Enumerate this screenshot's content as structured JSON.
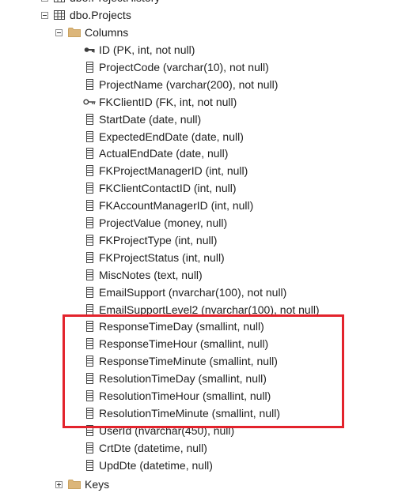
{
  "tree": {
    "top_cut_label": "dbo.ProjectHistory",
    "table_label": "dbo.Projects",
    "columns_folder_label": "Columns",
    "columns": [
      {
        "label": "ID (PK, int, not null)",
        "icon": "primary-key-icon"
      },
      {
        "label": "ProjectCode (varchar(10), not null)",
        "icon": "column-icon"
      },
      {
        "label": "ProjectName (varchar(200), not null)",
        "icon": "column-icon"
      },
      {
        "label": "FKClientID (FK, int, not null)",
        "icon": "foreign-key-icon"
      },
      {
        "label": "StartDate (date, null)",
        "icon": "column-icon"
      },
      {
        "label": "ExpectedEndDate (date, null)",
        "icon": "column-icon"
      },
      {
        "label": "ActualEndDate (date, null)",
        "icon": "column-icon"
      },
      {
        "label": "FKProjectManagerID (int, null)",
        "icon": "column-icon"
      },
      {
        "label": "FKClientContactID (int, null)",
        "icon": "column-icon"
      },
      {
        "label": "FKAccountManagerID (int, null)",
        "icon": "column-icon"
      },
      {
        "label": "ProjectValue (money, null)",
        "icon": "column-icon"
      },
      {
        "label": "FKProjectType (int, null)",
        "icon": "column-icon"
      },
      {
        "label": "FKProjectStatus (int, null)",
        "icon": "column-icon"
      },
      {
        "label": "MiscNotes (text, null)",
        "icon": "column-icon"
      },
      {
        "label": "EmailSupport (nvarchar(100), not null)",
        "icon": "column-icon"
      },
      {
        "label": "EmailSupportLevel2 (nvarchar(100), not null)",
        "icon": "column-icon"
      },
      {
        "label": "ResponseTimeDay (smallint, null)",
        "icon": "column-icon"
      },
      {
        "label": "ResponseTimeHour (smallint, null)",
        "icon": "column-icon"
      },
      {
        "label": "ResponseTimeMinute (smallint, null)",
        "icon": "column-icon"
      },
      {
        "label": "ResolutionTimeDay (smallint, null)",
        "icon": "column-icon"
      },
      {
        "label": "ResolutionTimeHour (smallint, null)",
        "icon": "column-icon"
      },
      {
        "label": "ResolutionTimeMinute (smallint, null)",
        "icon": "column-icon"
      },
      {
        "label": "UserId (nvarchar(450), null)",
        "icon": "column-icon"
      },
      {
        "label": "CrtDte (datetime, null)",
        "icon": "column-icon"
      },
      {
        "label": "UpdDte (datetime, null)",
        "icon": "column-icon"
      }
    ],
    "keys_folder_label": "Keys"
  },
  "colors": {
    "highlight": "#e3232c",
    "folder": "#dcb67a",
    "key": "#3c3c3c"
  }
}
